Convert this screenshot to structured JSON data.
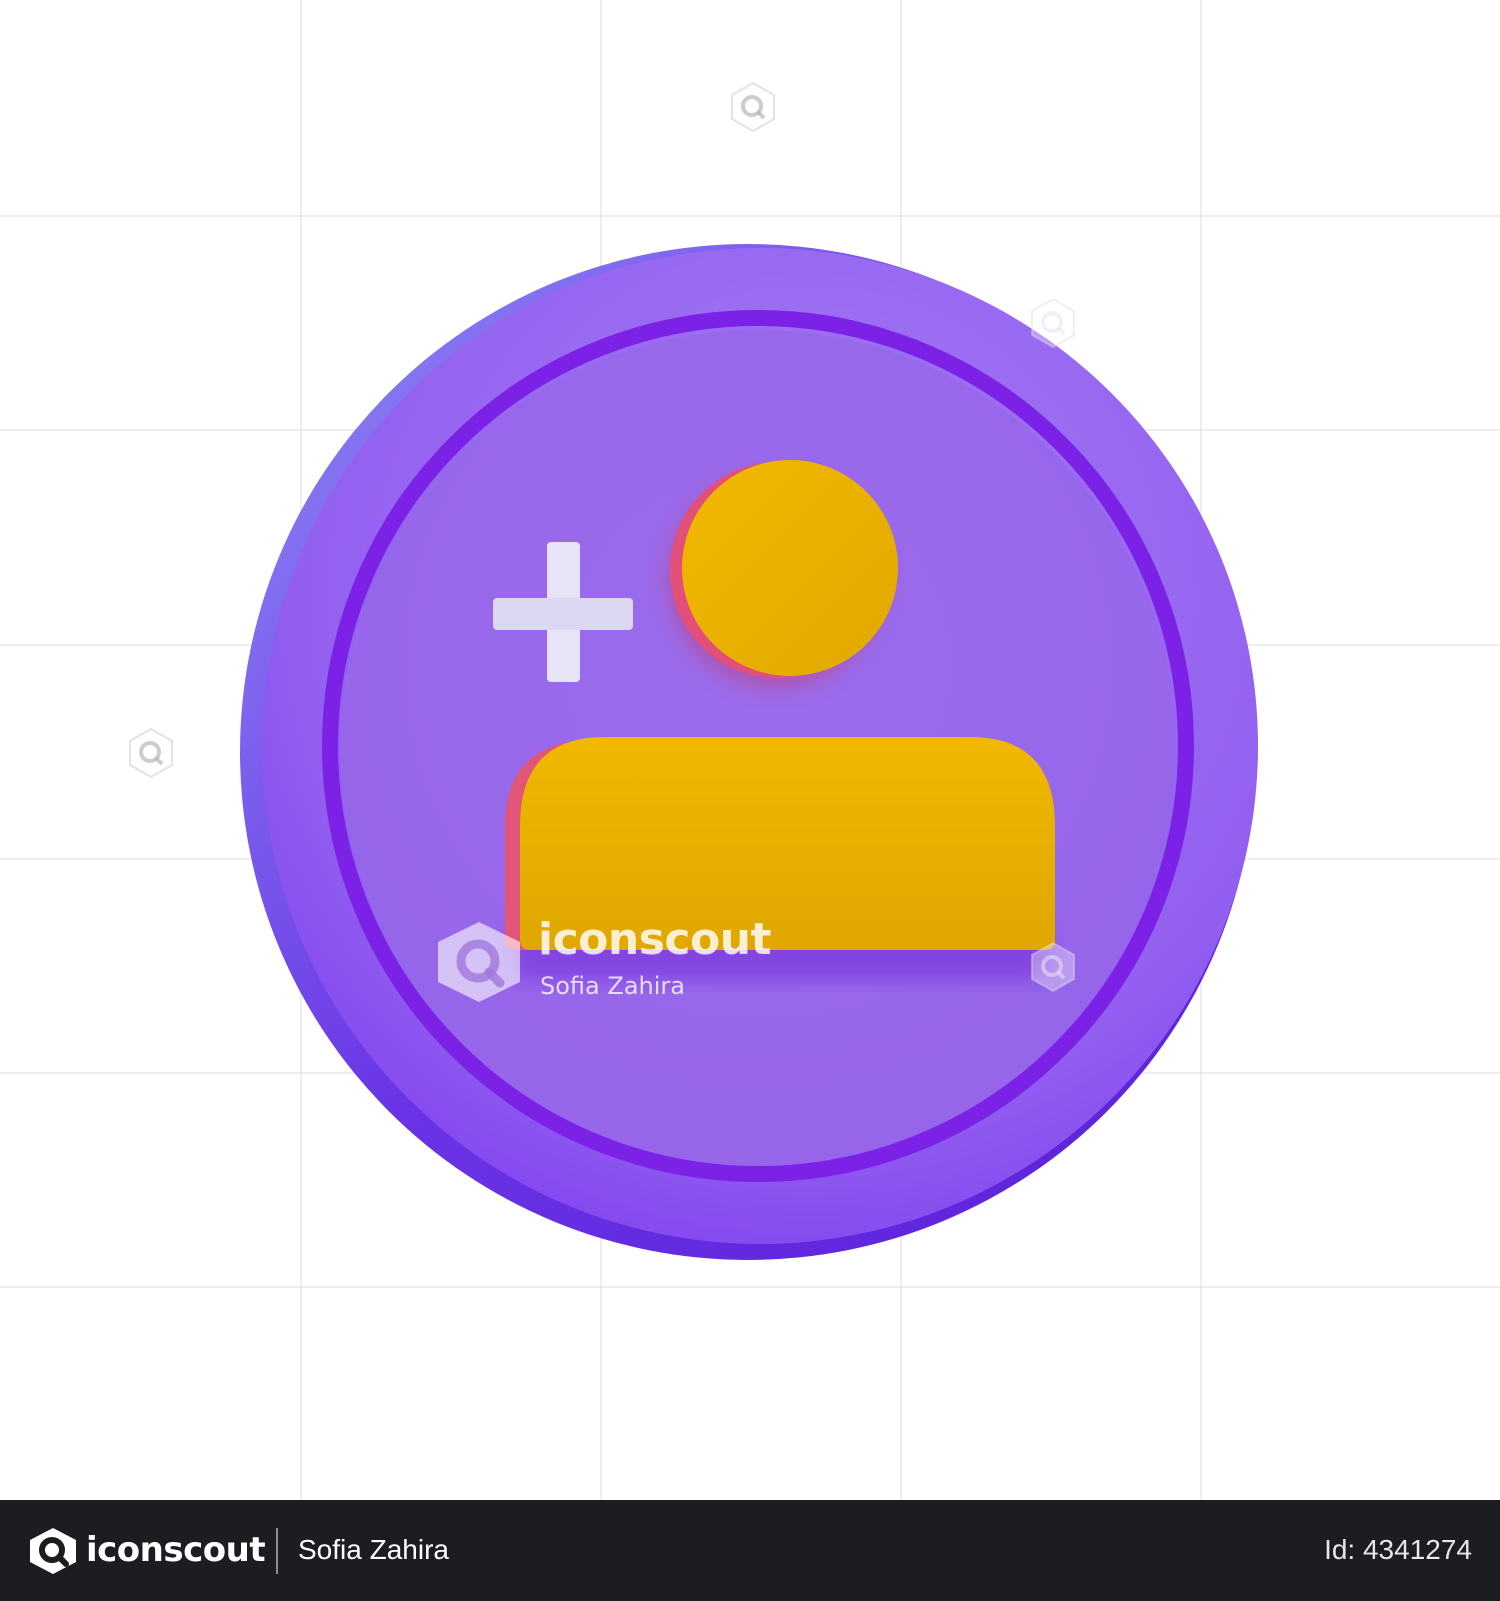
{
  "image": {
    "subject": "add-user-coin-icon",
    "background_color": "#ffffff",
    "grid_color": "#e3e3e3",
    "coin_colors": {
      "rim": "#8e58ee",
      "face": "#9a6aeb",
      "groove": "#7a1ee8",
      "person": "#e4ad00",
      "person_shadow": "#e0507a",
      "plus": "#dcd8f2"
    }
  },
  "watermark": {
    "brand": "iconscout",
    "author": "Sofia Zahira"
  },
  "footer": {
    "brand": "iconscout",
    "author": "Sofia Zahira",
    "id_text": "Id: 4341274",
    "background_color": "#1b1d21"
  }
}
